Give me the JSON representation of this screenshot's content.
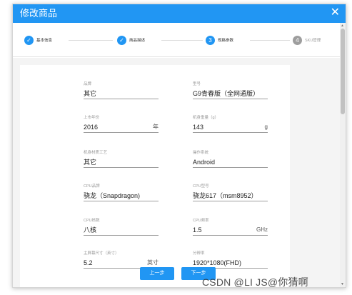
{
  "dialog": {
    "title": "修改商品",
    "close_icon": "close-icon"
  },
  "steps": [
    {
      "label": "基本信息",
      "marker": "✓",
      "state": "done"
    },
    {
      "label": "商品描述",
      "marker": "✓",
      "state": "done"
    },
    {
      "label": "规格参数",
      "marker": "3",
      "state": "active"
    },
    {
      "label": "SKU管理",
      "marker": "4",
      "state": "pending"
    }
  ],
  "fields": {
    "brand": {
      "label": "品牌",
      "value": "其它"
    },
    "model": {
      "label": "型号",
      "value": "G9青春版（全网通版）"
    },
    "release_year": {
      "label": "上市年份",
      "value": "2016",
      "unit": "年"
    },
    "weight": {
      "label": "机身重量（g）",
      "value": "143",
      "unit": "g"
    },
    "body_material": {
      "label": "机身材质工艺",
      "value": "其它"
    },
    "os": {
      "label": "操作系统",
      "value": "Android"
    },
    "cpu_brand": {
      "label": "CPU品牌",
      "value": "骁龙（Snapdragon)"
    },
    "cpu_model": {
      "label": "CPU型号",
      "value": "骁龙617（msm8952）"
    },
    "cpu_cores": {
      "label": "CPU核数",
      "value": "八核"
    },
    "cpu_freq": {
      "label": "CPU频率",
      "value": "1.5",
      "unit": "GHz"
    },
    "screen_size": {
      "label": "主屏幕尺寸（英寸）",
      "value": "5.2",
      "unit": "英寸"
    },
    "resolution": {
      "label": "分辨率",
      "value": "1920*1080(FHD)"
    }
  },
  "buttons": {
    "prev": "上一步",
    "next": "下一步"
  },
  "watermark": "CSDN @LI JS@你猜啊",
  "colors": {
    "primary": "#2196f3",
    "pending": "#9e9e9e"
  }
}
